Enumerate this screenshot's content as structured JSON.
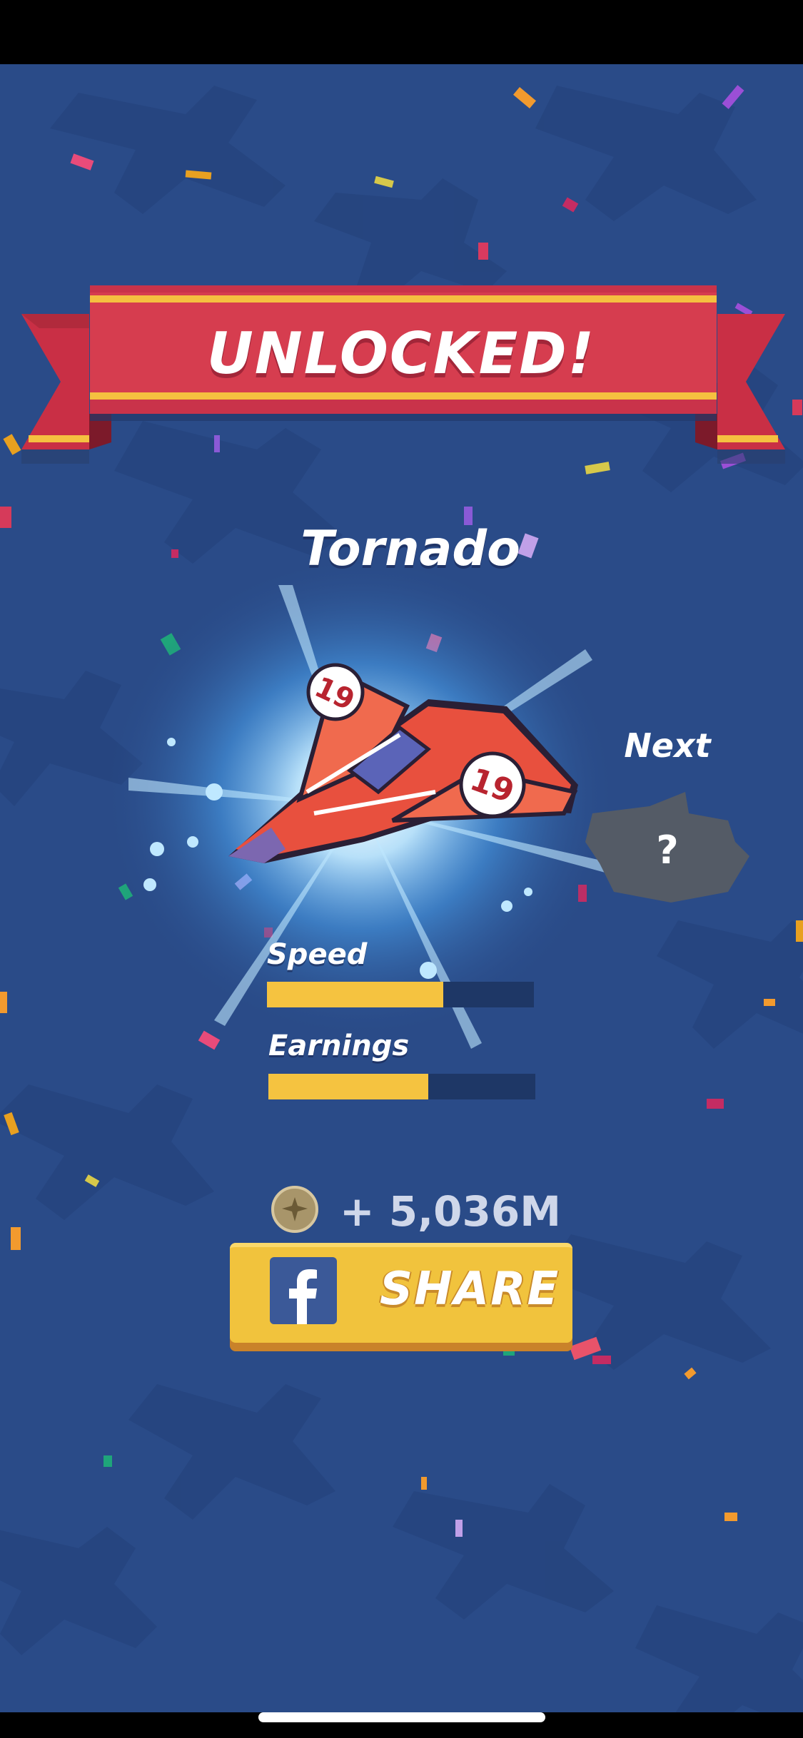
{
  "banner": {
    "title": "UNLOCKED!"
  },
  "plane": {
    "name": "Tornado",
    "number": "19"
  },
  "next": {
    "label": "Next",
    "mystery": "?"
  },
  "stats": [
    {
      "label": "Speed",
      "level": 0.66
    },
    {
      "label": "Earnings",
      "level": 0.6
    }
  ],
  "reward": {
    "amount": "+ 5,036M",
    "icon": "coin-icon"
  },
  "share": {
    "label": "SHARE",
    "icon": "facebook-icon"
  },
  "colors": {
    "background": "#2a4b88",
    "banner_red": "#d63d4f",
    "banner_stripe": "#f5c040",
    "bar_fill": "#f5c340",
    "bar_track": "#1e3766",
    "button": "#f1c33d",
    "facebook": "#3b5998"
  }
}
